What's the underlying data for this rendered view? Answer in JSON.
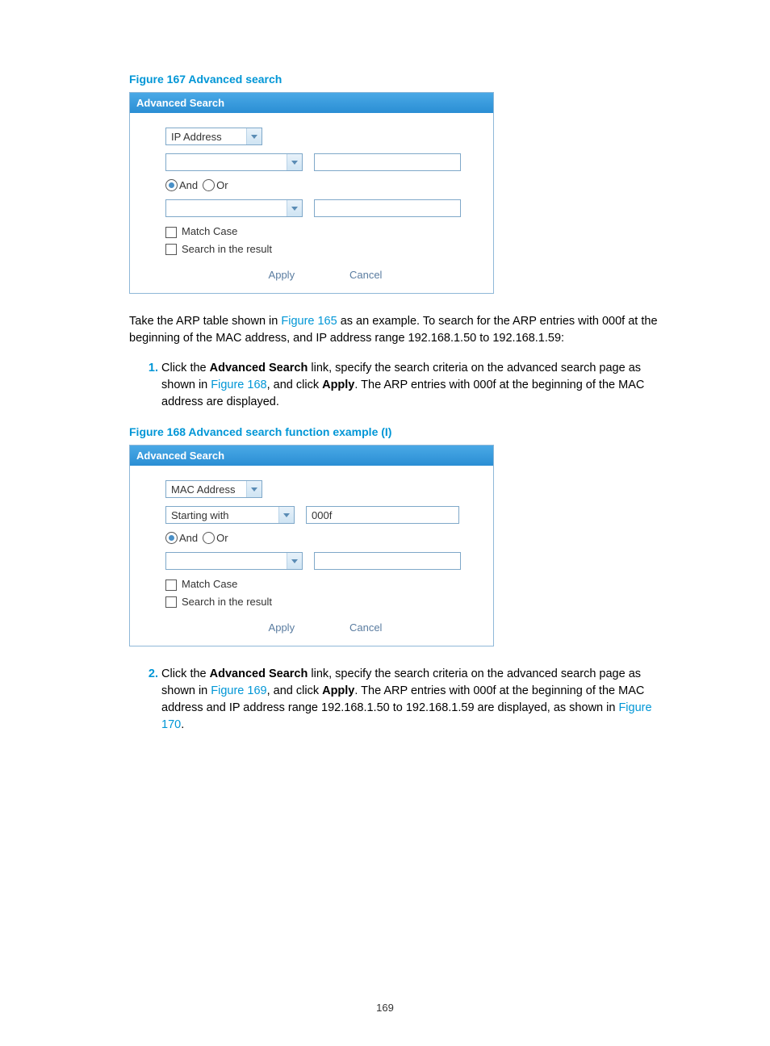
{
  "fig167": {
    "caption": "Figure 167 Advanced search",
    "panel_title": "Advanced Search",
    "field_dropdown": "IP Address",
    "op1": "",
    "val1": "",
    "and_label": "And",
    "or_label": "Or",
    "op2": "",
    "val2": "",
    "match_case": "Match Case",
    "search_in_result": "Search in the result",
    "apply": "Apply",
    "cancel": "Cancel"
  },
  "para1": {
    "t1": "Take the ARP table shown in ",
    "link": "Figure 165",
    "t2": " as an example. To search for the ARP entries with 000f at the beginning of the MAC address, and IP address range 192.168.1.50 to 192.168.1.59:"
  },
  "step1": {
    "t1": "Click the ",
    "b1": "Advanced Search",
    "t2": " link, specify the search criteria on the advanced search page as shown in ",
    "link": "Figure 168",
    "t3": ", and click ",
    "b2": "Apply",
    "t4": ". The ARP entries with 000f at the beginning of the MAC address are displayed."
  },
  "fig168": {
    "caption": "Figure 168 Advanced search function example (I)",
    "panel_title": "Advanced Search",
    "field_dropdown": "MAC Address",
    "op1": "Starting with",
    "val1": "000f",
    "and_label": "And",
    "or_label": "Or",
    "op2": "",
    "val2": "",
    "match_case": "Match Case",
    "search_in_result": "Search in the result",
    "apply": "Apply",
    "cancel": "Cancel"
  },
  "step2": {
    "t1": "Click the ",
    "b1": "Advanced Search",
    "t2": " link, specify the search criteria on the advanced search page as shown in ",
    "link1": "Figure 169",
    "t3": ", and click ",
    "b2": "Apply",
    "t4": ". The ARP entries with 000f at the beginning of the MAC address and IP address range 192.168.1.50 to 192.168.1.59 are displayed, as shown in ",
    "link2": "Figure 170",
    "t5": "."
  },
  "page_number": "169"
}
